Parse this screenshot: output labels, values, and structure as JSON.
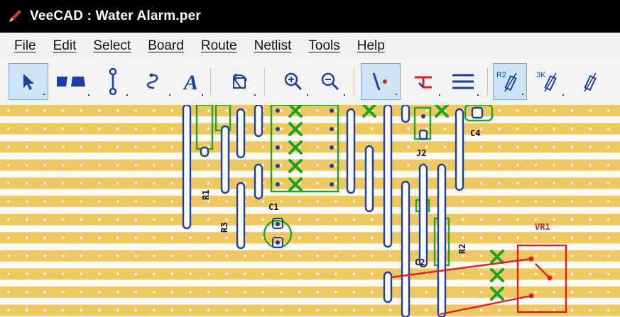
{
  "window": {
    "title": "VeeCAD : Water Alarm.per",
    "app_icon": "pencil-icon"
  },
  "menu": [
    "File",
    "Edit",
    "Select",
    "Board",
    "Route",
    "Netlist",
    "Tools",
    "Help"
  ],
  "toolbar": {
    "r2_label": "R2",
    "r3k_label": "3K"
  },
  "board": {
    "labels": {
      "R1": "R1",
      "R3": "R3",
      "C1": "C1",
      "C4": "C4",
      "J2": "J2",
      "R2": "R2",
      "C2": "C2",
      "VR1": "VR1"
    }
  },
  "colors": {
    "strip": "#f0c862",
    "board_bg": "#fbfbf5",
    "link": "#1f3fa0",
    "component_outline": "#27a427",
    "selection_red": "#e01e1e",
    "x_marker": "#1ea321",
    "title_bg": "#000000"
  }
}
